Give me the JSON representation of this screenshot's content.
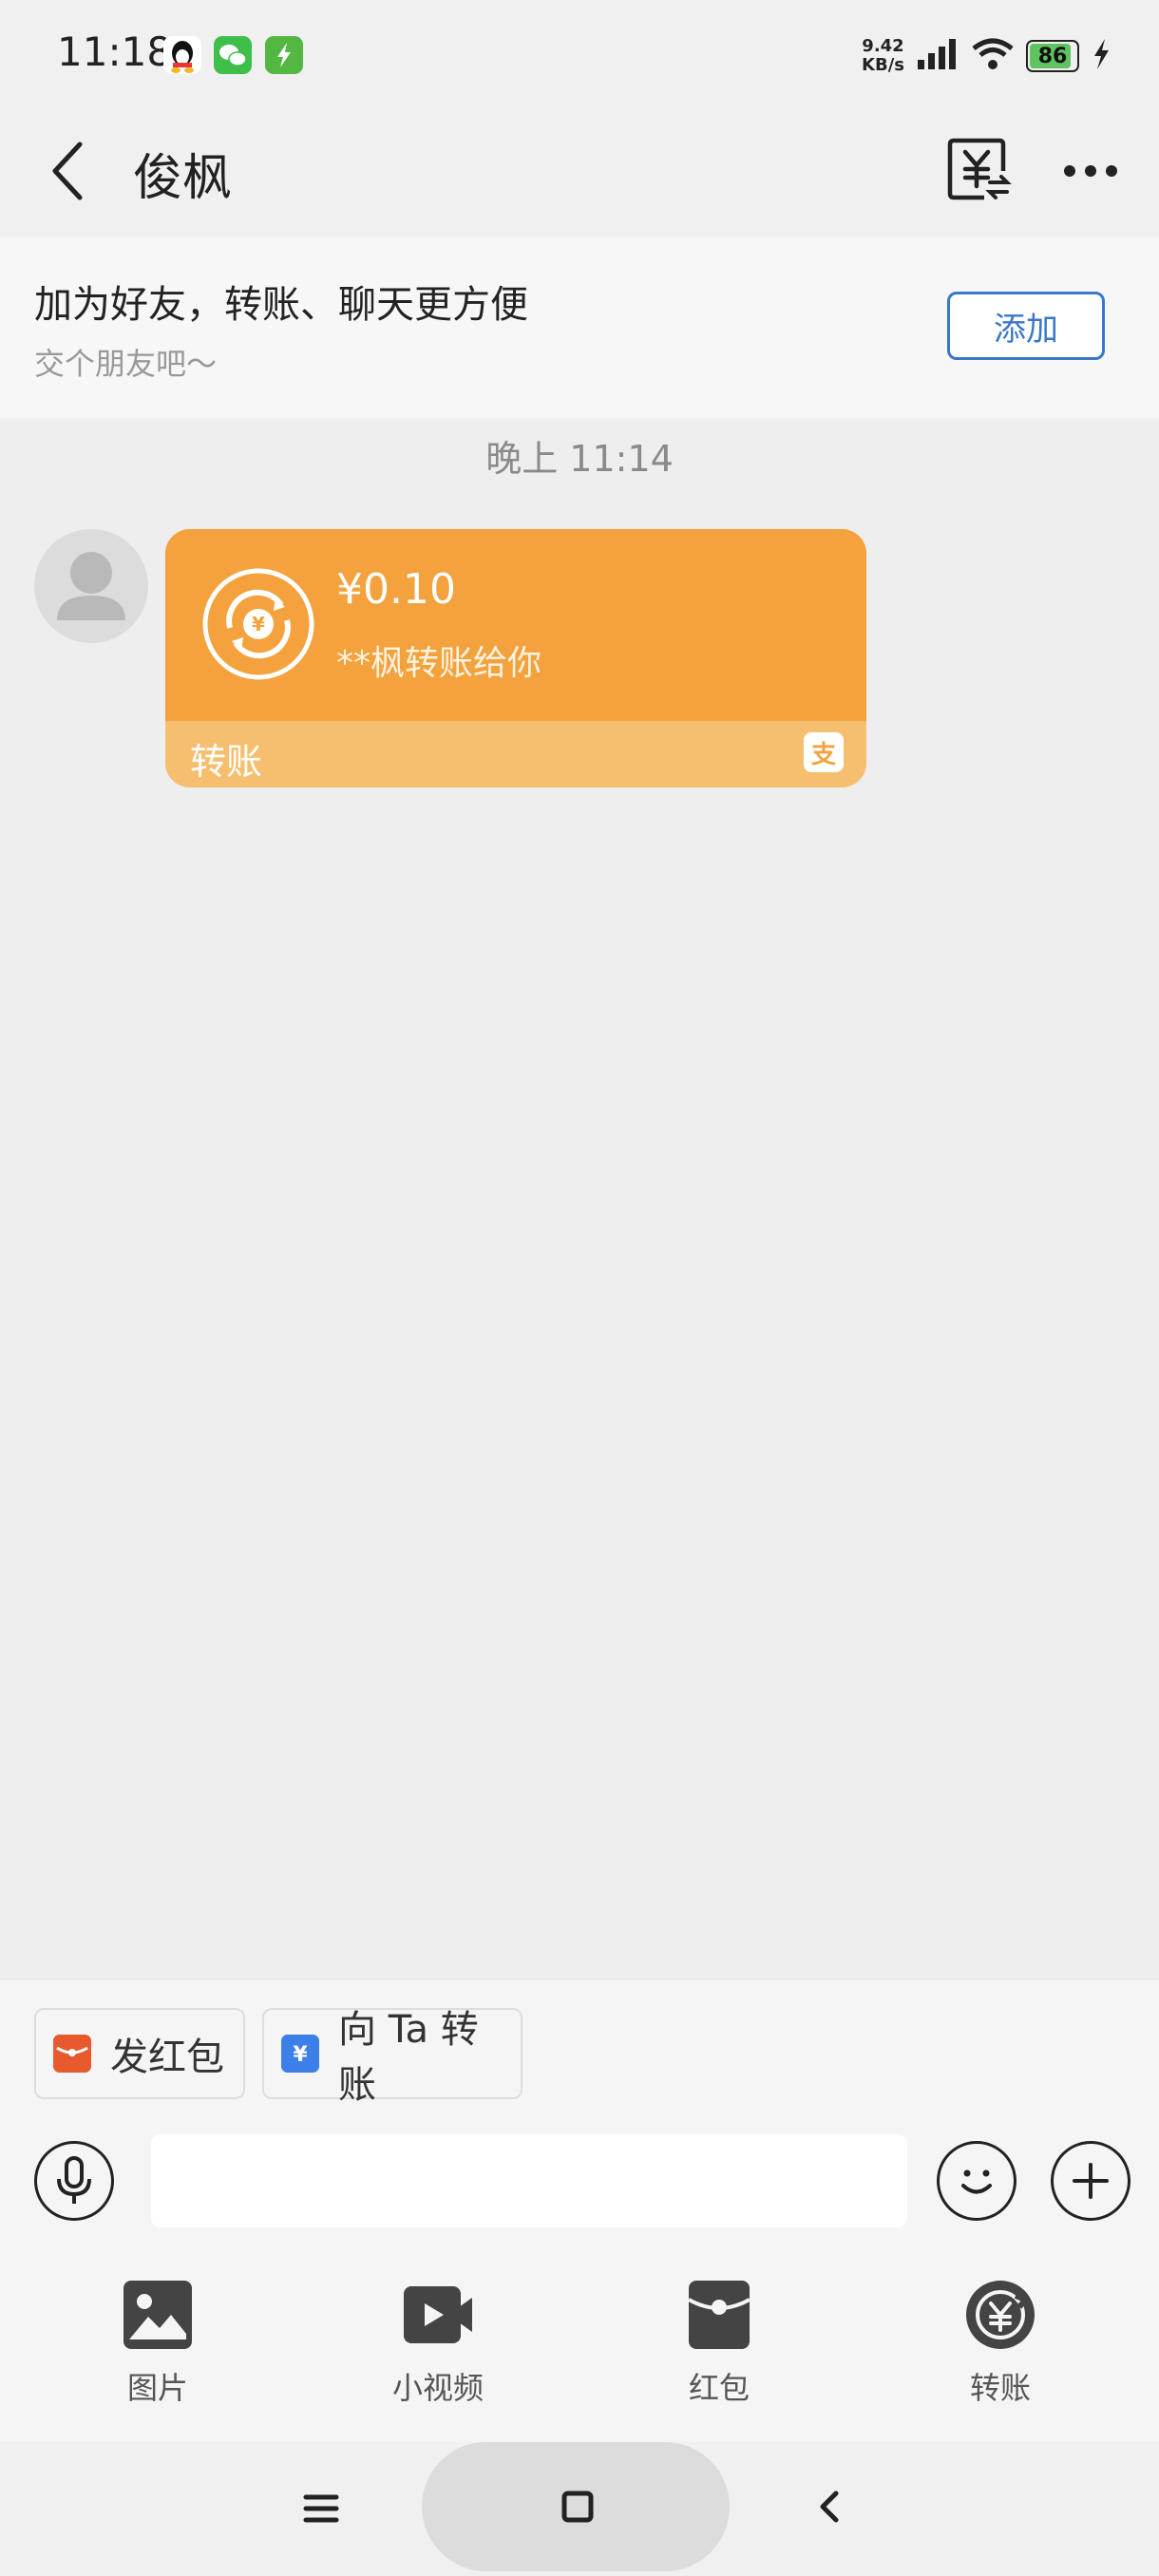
{
  "status_bar": {
    "time": "11:18",
    "net_speed_value": "9.42",
    "net_speed_unit": "KB/s",
    "battery": "86",
    "icons": [
      "qq-icon",
      "wechat-icon",
      "charge-app-icon",
      "signal-icon",
      "wifi-icon",
      "battery-icon",
      "charging-icon"
    ]
  },
  "nav": {
    "title": "俊枫",
    "back_icon": "chevron-left-icon",
    "transfer_icon": "yuan-transfer-icon",
    "more_icon": "more-dots-icon"
  },
  "banner": {
    "title": "加为好友，转账、聊天更方便",
    "subtitle": "交个朋友吧～",
    "add_label": "添加"
  },
  "chat": {
    "timestamp": "晚上 11:14",
    "transfer_card": {
      "amount": "¥0.10",
      "description": "**枫转账给你",
      "label": "转账",
      "brand_glyph": "支",
      "colors": {
        "top": "#f3a23d",
        "bottom": "#f6bf6f"
      }
    }
  },
  "quick_actions": [
    {
      "label": "发红包",
      "icon": "red-envelope-icon",
      "color": "#e8592e"
    },
    {
      "label": "向 Ta 转账",
      "icon": "transfer-card-icon",
      "color": "#3d7fe8"
    }
  ],
  "input": {
    "value": "",
    "placeholder": ""
  },
  "tools": [
    {
      "label": "图片",
      "icon": "image-icon"
    },
    {
      "label": "小视频",
      "icon": "video-icon"
    },
    {
      "label": "红包",
      "icon": "red-packet-icon"
    },
    {
      "label": "转账",
      "icon": "yuan-refresh-icon"
    }
  ],
  "system_nav": {
    "icons": [
      "menu-icon",
      "home-icon",
      "back-icon"
    ]
  },
  "accent_color": "#3a77c9"
}
